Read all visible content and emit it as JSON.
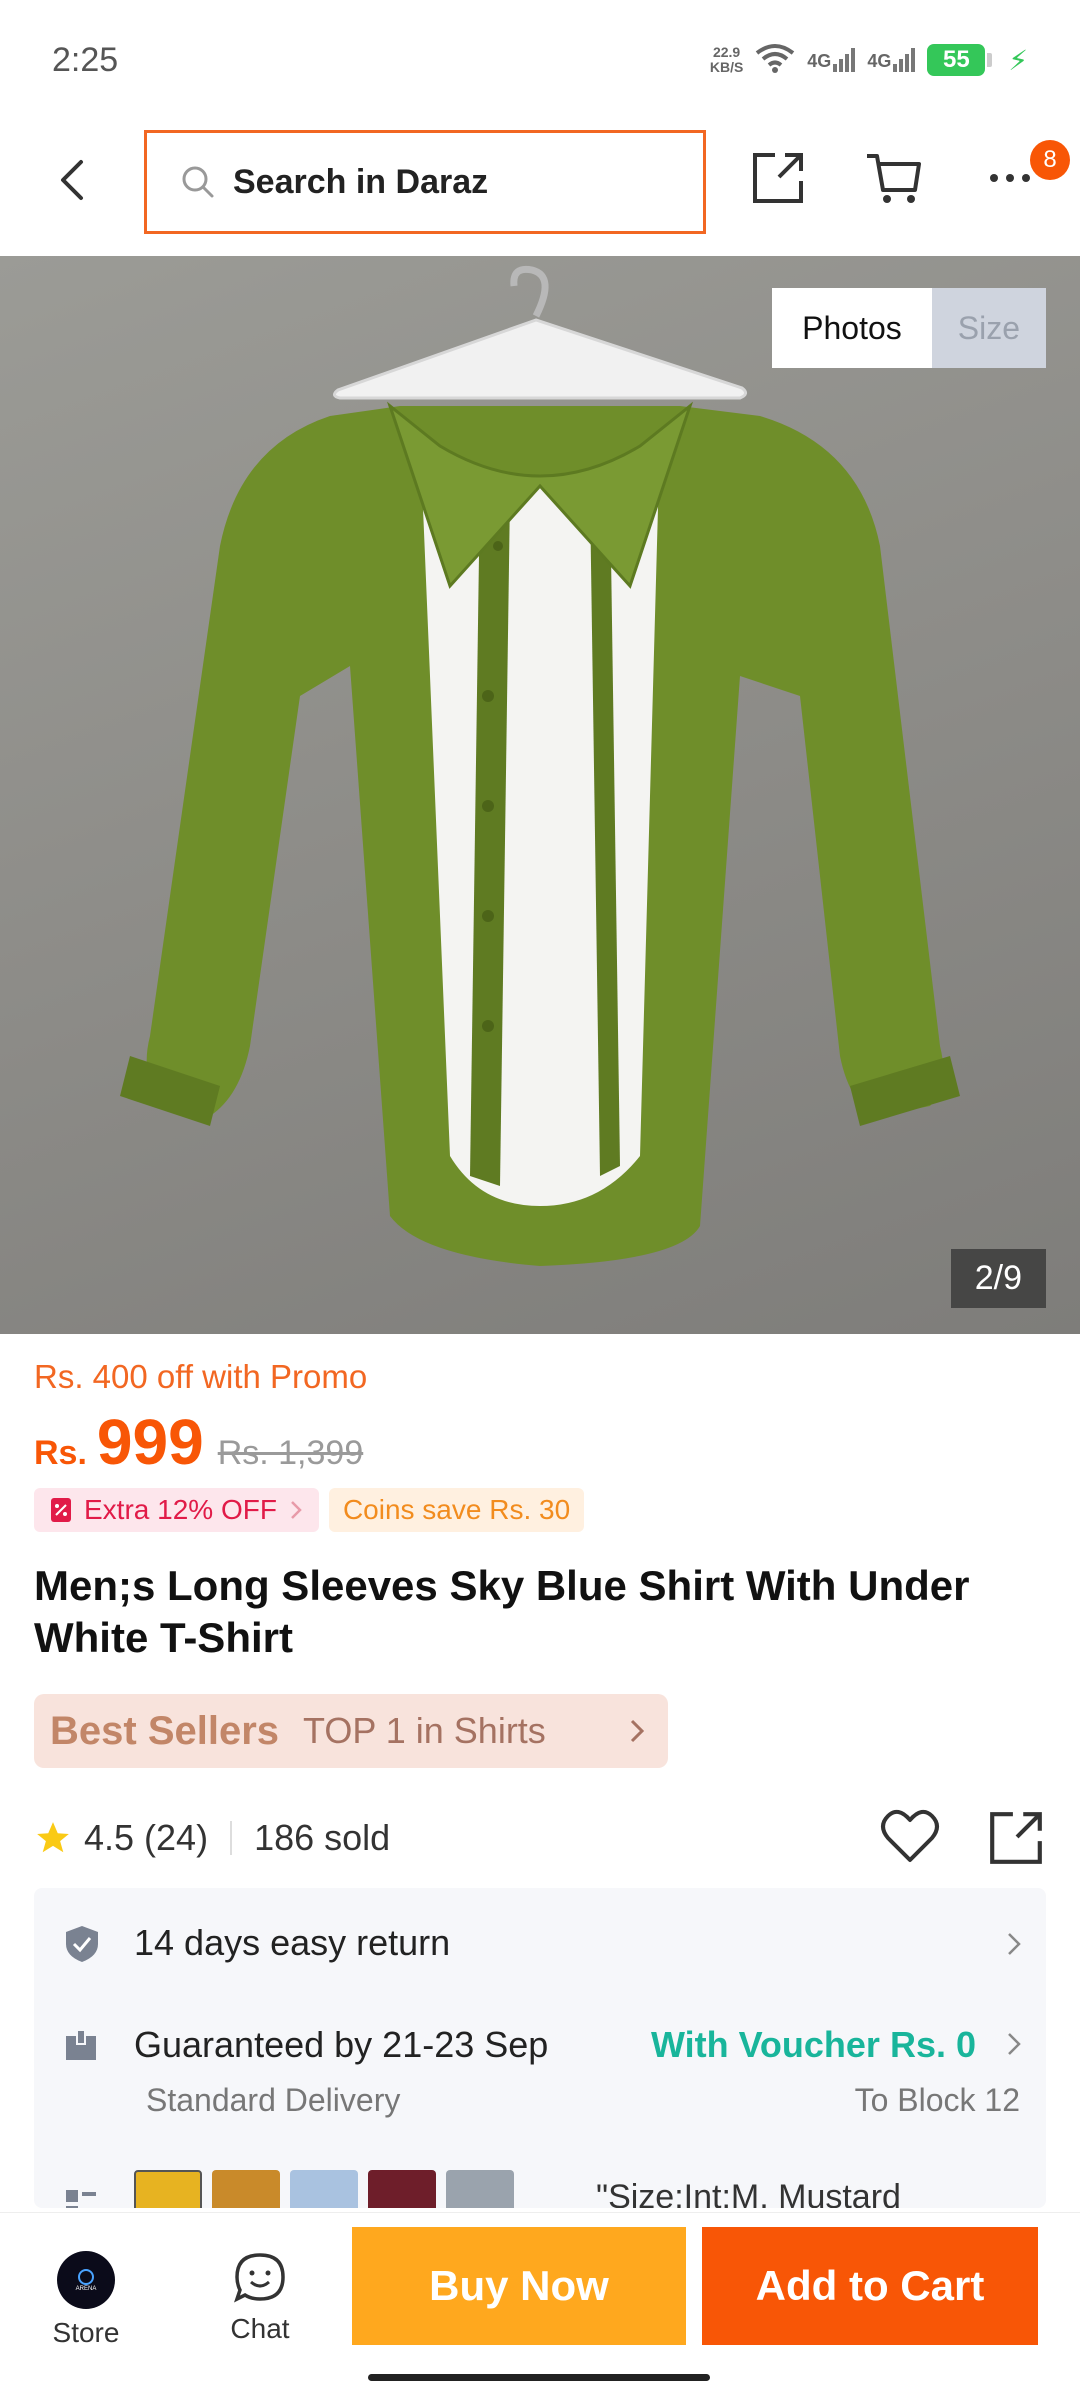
{
  "status_bar": {
    "time": "2:25",
    "net_speed_value": "22.9",
    "net_speed_unit": "KB/S",
    "network_1": "4G",
    "network_2": "4G",
    "battery": "55"
  },
  "header": {
    "search_placeholder": "Search in Daraz",
    "notification_count": "8"
  },
  "gallery": {
    "tabs": [
      "Photos",
      "Size"
    ],
    "active_tab": "Photos",
    "counter": "2/9"
  },
  "pricing": {
    "promo_text": "Rs. 400 off with Promo",
    "currency": "Rs.",
    "price": "999",
    "original_price": "Rs. 1,399",
    "extra_off": "Extra 12% OFF",
    "coins_save": "Coins save Rs. 30"
  },
  "product": {
    "title": "Men;s Long Sleeves Sky Blue Shirt With Under White T-Shirt",
    "best_sellers_logo": "Best Sellers",
    "best_sellers_rank": "TOP 1 in Shirts",
    "rating": "4.5 (24)",
    "sold": "186 sold"
  },
  "services": {
    "return_policy": "14 days easy return",
    "delivery_guarantee": "Guaranteed by 21-23 Sep",
    "voucher": "With Voucher Rs. 0",
    "delivery_type": "Standard Delivery",
    "delivery_location": "To Block 12",
    "variant": "\"Size:Int:M, Mustard",
    "variant_colors": [
      "#e7b321",
      "#c98a2a",
      "#a9c2e0",
      "#6e1e2a",
      "#9aa3ad"
    ]
  },
  "bottom_bar": {
    "store_label": "Store",
    "store_logo_text": "ARENA",
    "chat_label": "Chat",
    "buy_now": "Buy Now",
    "add_to_cart": "Add to Cart"
  },
  "colors": {
    "brand_orange": "#f85606",
    "buy_now_yellow": "#ffa81e",
    "voucher_teal": "#19b59b",
    "shirt_green": "#6f8e2a"
  }
}
